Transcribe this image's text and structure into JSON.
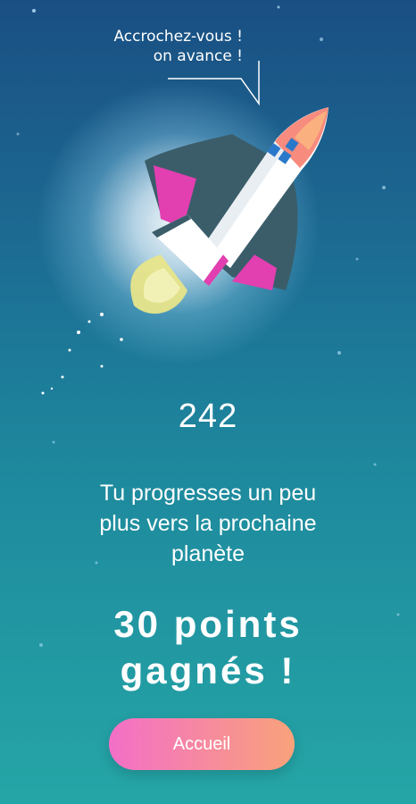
{
  "speech": {
    "line1": "Accrochez-vous !",
    "line2": "on avance !"
  },
  "progress": {
    "count": "242",
    "message_line1": "Tu progresses un peu",
    "message_line2": "plus vers la prochaine",
    "message_line3": "planète"
  },
  "reward": {
    "line1": "30 points",
    "line2": "gagnés !"
  },
  "buttons": {
    "home_label": "Accueil"
  },
  "colors": {
    "background_top": "#1a4f83",
    "background_bottom": "#25a6a6",
    "button_start": "#f36fc7",
    "button_end": "#f9a27a",
    "rocket_accent": "#e23fb0",
    "rocket_nose": "#f78b7e"
  },
  "icons": {
    "rocket": "rocket-icon",
    "flame": "flame-icon"
  }
}
